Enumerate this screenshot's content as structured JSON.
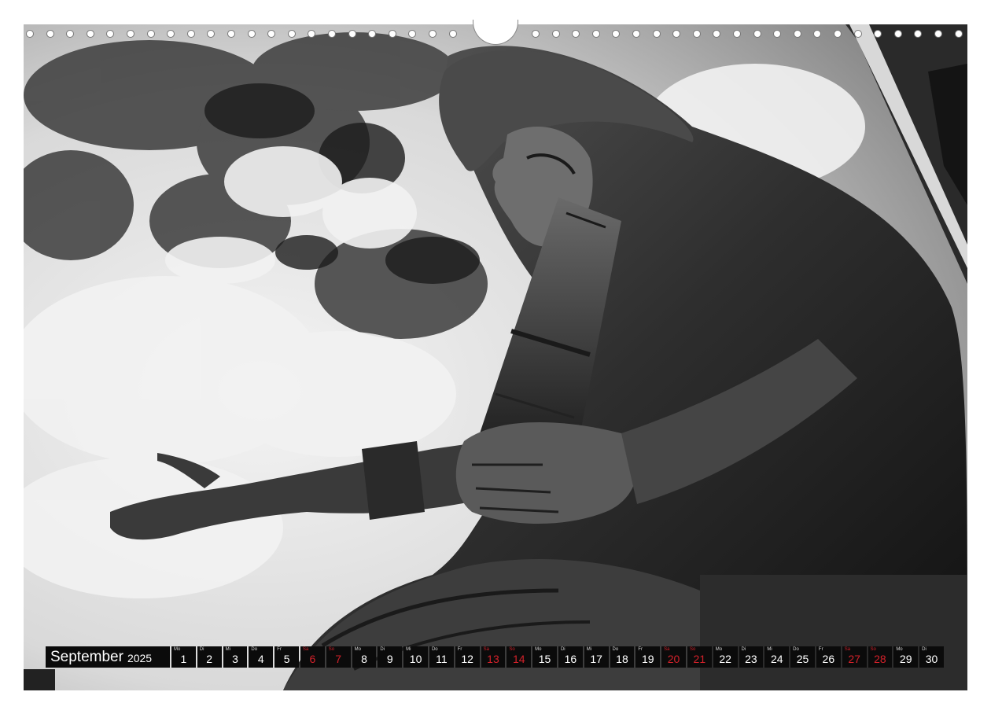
{
  "calendar": {
    "month_name": "September",
    "year": "2025",
    "weekend_color": "#d3212a",
    "days": [
      {
        "weekday": "Mo",
        "day": "1",
        "weekend": false
      },
      {
        "weekday": "Di",
        "day": "2",
        "weekend": false
      },
      {
        "weekday": "Mi",
        "day": "3",
        "weekend": false
      },
      {
        "weekday": "Do",
        "day": "4",
        "weekend": false
      },
      {
        "weekday": "Fr",
        "day": "5",
        "weekend": false
      },
      {
        "weekday": "Sa",
        "day": "6",
        "weekend": true
      },
      {
        "weekday": "So",
        "day": "7",
        "weekend": true
      },
      {
        "weekday": "Mo",
        "day": "8",
        "weekend": false
      },
      {
        "weekday": "Di",
        "day": "9",
        "weekend": false
      },
      {
        "weekday": "Mi",
        "day": "10",
        "weekend": false
      },
      {
        "weekday": "Do",
        "day": "11",
        "weekend": false
      },
      {
        "weekday": "Fr",
        "day": "12",
        "weekend": false
      },
      {
        "weekday": "Sa",
        "day": "13",
        "weekend": true
      },
      {
        "weekday": "So",
        "day": "14",
        "weekend": true
      },
      {
        "weekday": "Mo",
        "day": "15",
        "weekend": false
      },
      {
        "weekday": "Di",
        "day": "16",
        "weekend": false
      },
      {
        "weekday": "Mi",
        "day": "17",
        "weekend": false
      },
      {
        "weekday": "Do",
        "day": "18",
        "weekend": false
      },
      {
        "weekday": "Fr",
        "day": "19",
        "weekend": false
      },
      {
        "weekday": "Sa",
        "day": "20",
        "weekend": true
      },
      {
        "weekday": "So",
        "day": "21",
        "weekend": true
      },
      {
        "weekday": "Mo",
        "day": "22",
        "weekend": false
      },
      {
        "weekday": "Di",
        "day": "23",
        "weekend": false
      },
      {
        "weekday": "Mi",
        "day": "24",
        "weekend": false
      },
      {
        "weekday": "Do",
        "day": "25",
        "weekend": false
      },
      {
        "weekday": "Fr",
        "day": "26",
        "weekend": false
      },
      {
        "weekday": "Sa",
        "day": "27",
        "weekend": true
      },
      {
        "weekday": "So",
        "day": "28",
        "weekend": true
      },
      {
        "weekday": "Mo",
        "day": "29",
        "weekend": false
      },
      {
        "weekday": "Di",
        "day": "30",
        "weekend": false
      }
    ]
  }
}
